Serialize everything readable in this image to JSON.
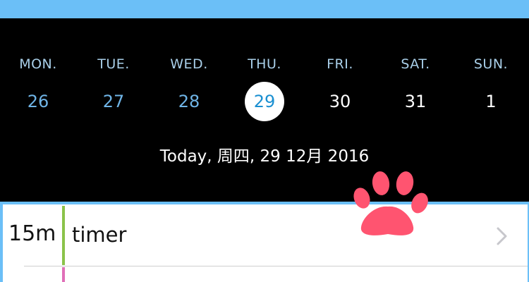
{
  "week": {
    "days": [
      {
        "name": "MON.",
        "num": "26"
      },
      {
        "name": "TUE.",
        "num": "27"
      },
      {
        "name": "WED.",
        "num": "28"
      },
      {
        "name": "THU.",
        "num": "29"
      },
      {
        "name": "FRI.",
        "num": "30"
      },
      {
        "name": "SAT.",
        "num": "31"
      },
      {
        "name": "SUN.",
        "num": "1"
      }
    ],
    "selected_index": 3,
    "today_label": "Today, 周四, 29 12月 2016"
  },
  "colors": {
    "header_blue": "#6bbff7",
    "day_name": "#a9cfe9",
    "past_day": "#6fb4e6",
    "selected_text": "#1a8fd1",
    "future_day": "#ffffff",
    "paw": "#ff5470",
    "timer_bar": "#8bc34a",
    "next_bar": "#e06fb8"
  },
  "entries": [
    {
      "duration": "15m",
      "title": "timer"
    }
  ],
  "icons": {
    "decoration": "paw-print-icon",
    "row_action": "chevron-right-icon"
  }
}
